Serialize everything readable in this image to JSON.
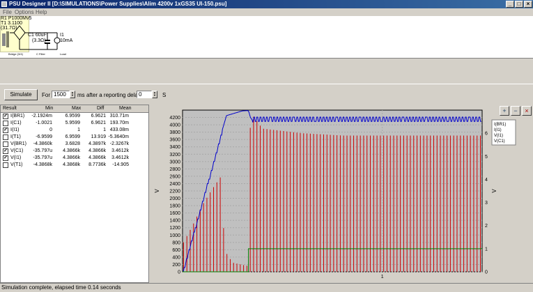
{
  "window": {
    "title": "PSU Designer II  [D:\\SIMULATIONS\\Power Supplies\\Alim 4200v 1xGS35 UI-150.psu]",
    "minimize_glyph": "_",
    "maximize_glyph": "□",
    "close_glyph": "×"
  },
  "menu": {
    "file": "File",
    "options": "Options",
    "help": "Help"
  },
  "schematic": {
    "r1": "R1 P1000Mv5",
    "t1": "T1 3.1100",
    "t1b": "(31.7Ω)",
    "cap": "C1 60uF",
    "cap_r": "(3.3Ω)",
    "i1": "I1",
    "load": "10mA",
    "bridge_caption": "Bridge (3/4)",
    "filter_caption": "C Filter",
    "load_caption": "Load"
  },
  "toolbar": {
    "simulate_label": "Simulate",
    "for_label": "For",
    "duration": "1500",
    "ms_label": "ms",
    "delay_label": "after a reporting delay of",
    "delay": "0",
    "s_label": "S"
  },
  "table": {
    "headers": [
      "Result",
      "Min",
      "Max",
      "Diff",
      "Mean"
    ],
    "rows": [
      {
        "checked": true,
        "name": "I(BR1)",
        "min": "-2.1924m",
        "max": "6.9599",
        "diff": "6.9621",
        "mean": "310.71m"
      },
      {
        "checked": false,
        "name": "I(C1)",
        "min": "-1.0021",
        "max": "5.9599",
        "diff": "6.9621",
        "mean": "193.70m"
      },
      {
        "checked": true,
        "name": "I(I1)",
        "min": "0",
        "max": "1",
        "diff": "1",
        "mean": "433.08m"
      },
      {
        "checked": false,
        "name": "I(T1)",
        "min": "-6.9599",
        "max": "6.9599",
        "diff": "13.919",
        "mean": "-5.3640m"
      },
      {
        "checked": false,
        "name": "V(BR1)",
        "min": "-4.3860k",
        "max": "3.6828",
        "diff": "4.3897k",
        "mean": "-2.3267k"
      },
      {
        "checked": true,
        "name": "V(C1)",
        "min": "-35.797u",
        "max": "4.3866k",
        "diff": "4.3866k",
        "mean": "3.4612k"
      },
      {
        "checked": true,
        "name": "V(I1)",
        "min": "-35.797u",
        "max": "4.3866k",
        "diff": "4.3866k",
        "mean": "3.4612k"
      },
      {
        "checked": false,
        "name": "V(T1)",
        "min": "-4.3868k",
        "max": "4.3868k",
        "diff": "8.7736k",
        "mean": "-14.905"
      }
    ]
  },
  "chart_data": {
    "type": "line",
    "xlabel": "",
    "xlim": [
      0,
      1.5
    ],
    "x_ticks": [
      1
    ],
    "ylabel_left": "V",
    "ylabel_right": "V",
    "ylim_left": [
      0,
      4400
    ],
    "left_ticks": [
      0,
      200,
      400,
      600,
      800,
      1000,
      1200,
      1400,
      1600,
      1800,
      2000,
      2200,
      2400,
      2600,
      2800,
      3000,
      3200,
      3400,
      3600,
      3800,
      4000,
      4200
    ],
    "ylim_right": [
      0,
      7
    ],
    "right_ticks": [
      0,
      1,
      2,
      3,
      4,
      5,
      6
    ],
    "legend": [
      "I(BR1)",
      "I(I1)",
      "V(I1)",
      "V(C1)"
    ],
    "legend_position": "right",
    "grid": true,
    "colors": {
      "I(BR1)": "#cc0000",
      "I(I1)": "#008000",
      "V(C1)": "#0000cc",
      "background": "#c0c0c0"
    },
    "series": [
      {
        "name": "V(C1)",
        "axis": "left",
        "x": [
          0,
          0.2,
          0.22,
          0.3,
          0.33,
          0.34,
          0.35,
          0.36,
          1.5
        ],
        "y": [
          0,
          3880,
          4250,
          4380,
          4386,
          4200,
          4120,
          4150,
          4150
        ]
      },
      {
        "name": "I(I1)",
        "axis": "right",
        "x": [
          0,
          0.33,
          0.33,
          1.5
        ],
        "y": [
          0,
          0,
          1,
          1
        ]
      },
      {
        "name": "I(BR1) peak envelope",
        "axis": "right",
        "x": [
          0,
          0.05,
          0.1,
          0.15,
          0.19,
          0.2,
          0.22,
          0.25,
          0.3,
          0.33,
          0.34,
          0.4,
          0.6,
          0.8,
          1.0,
          1.2,
          1.5
        ],
        "y": [
          1.2,
          2.0,
          2.9,
          3.6,
          4.1,
          2.3,
          0.8,
          0.4,
          0.3,
          0.25,
          6.9,
          6.2,
          6.0,
          5.9,
          5.9,
          5.9,
          5.9
        ]
      }
    ]
  },
  "status": {
    "text": "Simulation complete, elapsed time 0.14 seconds"
  }
}
